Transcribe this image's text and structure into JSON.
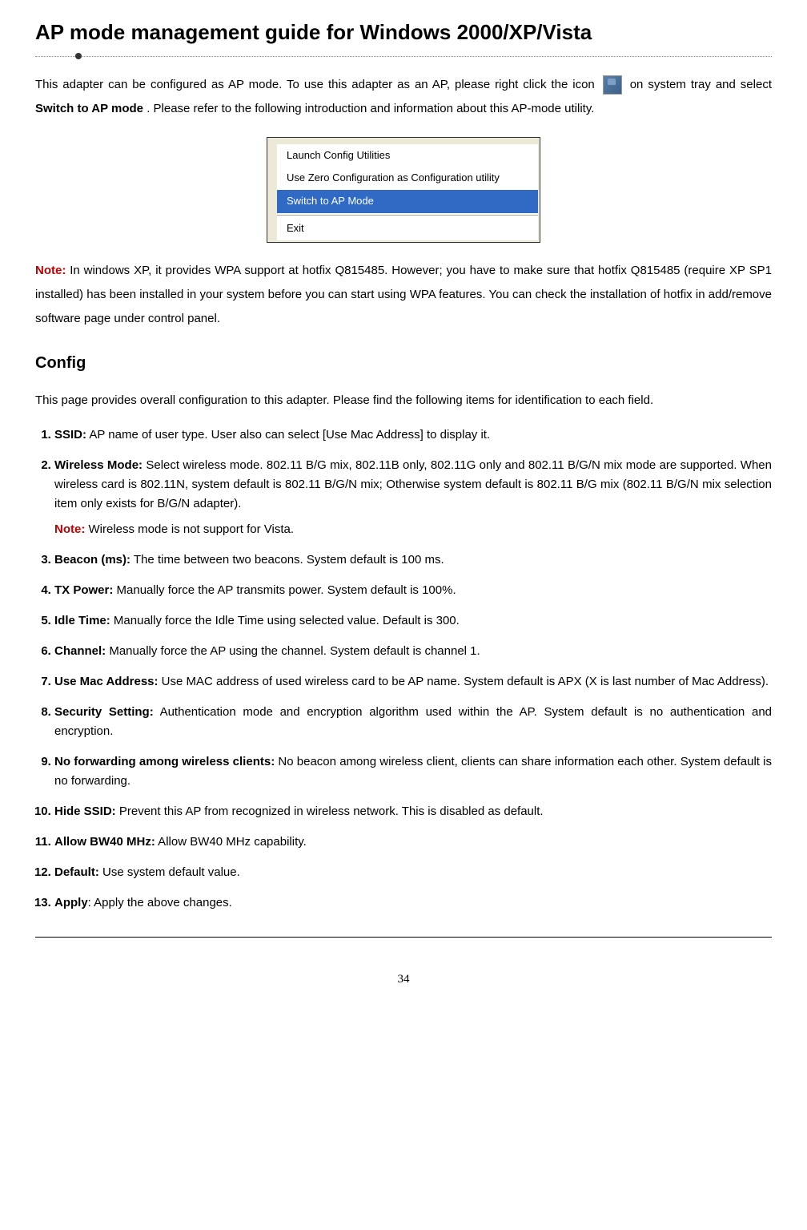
{
  "title": "AP mode management guide for Windows 2000/XP/Vista",
  "intro": {
    "part1": "This adapter can be configured as AP mode. To use this adapter as an AP, please right click the icon ",
    "part2": " on system tray and select ",
    "bold": "Switch to AP mode",
    "part3": ". Please refer to the following introduction and information about this AP-mode utility."
  },
  "menu": {
    "items": [
      "Launch Config Utilities",
      "Use Zero Configuration as Configuration utility",
      "Switch to AP Mode",
      "Exit"
    ],
    "selected_index": 2
  },
  "note1": {
    "label": "Note:",
    "text": " In windows XP, it provides WPA support at hotfix Q815485. However; you have to make sure that hotfix Q815485 (require XP SP1 installed) has been installed in your system before you can start using WPA features. You can check the installation of hotfix in add/remove software page under control panel."
  },
  "config": {
    "heading": "Config",
    "desc": "This page provides overall configuration to this adapter. Please find the following items for identification to each field.",
    "items": [
      {
        "label": "SSID:",
        "text": " AP name of user type. User also can select [Use Mac Address] to display it."
      },
      {
        "label": "Wireless Mode:",
        "text": " Select wireless mode. 802.11 B/G mix, 802.11B only, 802.11G only and 802.11 B/G/N mix mode are supported. When wireless card is 802.11N, system default is 802.11 B/G/N mix; Otherwise system default is 802.11 B/G mix (802.11 B/G/N mix selection item only exists for B/G/N adapter).",
        "note_label": "Note:",
        "note_text": " Wireless mode is not support for Vista."
      },
      {
        "label": "Beacon (ms):",
        "text": " The time between two beacons. System default is 100 ms."
      },
      {
        "label": "TX Power:",
        "text": " Manually force the AP transmits power. System default is 100%."
      },
      {
        "label": "Idle Time:",
        "text": " Manually force the Idle Time using selected value. Default is 300."
      },
      {
        "label": "Channel:",
        "text": " Manually force the AP using the channel. System default is channel 1."
      },
      {
        "label": "Use Mac Address:",
        "text": " Use MAC address of used wireless card to be AP name. System default is APX (X is last number of Mac Address)."
      },
      {
        "label": "Security Setting:",
        "text": " Authentication mode and encryption algorithm used within the AP. System default is no authentication and encryption."
      },
      {
        "label": "No forwarding among wireless clients:",
        "text": " No beacon among wireless client, clients can share information each other. System default is no forwarding."
      },
      {
        "label": "Hide SSID:",
        "text": " Prevent this AP from recognized in wireless network. This is disabled as default."
      },
      {
        "label": "Allow BW40 MHz:",
        "text": " Allow BW40 MHz capability."
      },
      {
        "label": "Default:",
        "text": " Use system default value."
      },
      {
        "label": "Apply",
        "text": ": Apply the above changes."
      }
    ]
  },
  "page_number": "34"
}
